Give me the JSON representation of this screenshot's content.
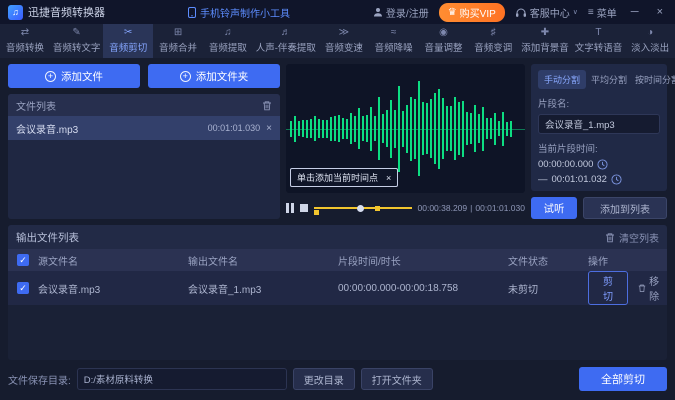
{
  "titlebar": {
    "app_name": "迅捷音频转换器",
    "promo": "手机铃声制作小工具",
    "login": "登录/注册",
    "vip": "购买VIP",
    "support": "客服中心",
    "menu": "菜单",
    "minimize": "─",
    "close": "×"
  },
  "tabs": [
    {
      "label": "音频转换",
      "icon": "⇄"
    },
    {
      "label": "音频转文字",
      "icon": "✎"
    },
    {
      "label": "音频剪切",
      "icon": "✂"
    },
    {
      "label": "音频合并",
      "icon": "⊞"
    },
    {
      "label": "音频提取",
      "icon": "♫"
    },
    {
      "label": "人声-伴奏提取",
      "icon": "♬"
    },
    {
      "label": "音频变速",
      "icon": "≫"
    },
    {
      "label": "音频降噪",
      "icon": "≈"
    },
    {
      "label": "音量调整",
      "icon": "◉"
    },
    {
      "label": "音频变调",
      "icon": "♯"
    },
    {
      "label": "添加背景音",
      "icon": "✚"
    },
    {
      "label": "文字转语音",
      "icon": "T"
    },
    {
      "label": "淡入淡出",
      "icon": "◑"
    }
  ],
  "file_panel": {
    "add_file": "添加文件",
    "add_folder": "添加文件夹",
    "list_title": "文件列表",
    "clear_list": "清空列表",
    "file": {
      "name": "会议录音.mp3",
      "duration": "00:01:01.030",
      "remove": "×"
    }
  },
  "player": {
    "current_time": "00:00:38.209",
    "separator": "|",
    "total_time": "00:01:01.030",
    "tooltip": "单击添加当前时间点",
    "tooltip_close": "×",
    "preview": "试听",
    "add_to_list": "添加到列表"
  },
  "split_panel": {
    "tabs": [
      {
        "label": "手动分割"
      },
      {
        "label": "平均分割"
      },
      {
        "label": "按时间分割"
      }
    ],
    "segment_name_label": "片段名:",
    "segment_name": "会议录音_1.mp3",
    "segment_time_label": "当前片段时间:",
    "start_time": "00:00:00.000",
    "dash": "—",
    "end_time": "00:01:01.032"
  },
  "output": {
    "title": "输出文件列表",
    "clear_list": "清空列表",
    "columns": {
      "source": "源文件名",
      "output": "输出文件名",
      "time": "片段时间/时长",
      "status": "文件状态",
      "actions": "操作"
    },
    "rows": [
      {
        "source": "会议录音.mp3",
        "output": "会议录音_1.mp3",
        "time": "00:00:00.000-00:00:18.758",
        "status": "未剪切",
        "cut": "剪切",
        "remove": "移除"
      }
    ],
    "check_glyph": "✓"
  },
  "bottom": {
    "save_dir_label": "文件保存目录:",
    "save_dir": "D:/素材原料转换",
    "change_dir": "更改目录",
    "open_folder": "打开文件夹",
    "cut_all": "全部剪切"
  },
  "colors": {
    "accent_blue": "#3e6bf2",
    "vip_orange": "#ff8d32",
    "waveform_green": "#0ddd82",
    "timeline_yellow": "#f2c52e"
  }
}
